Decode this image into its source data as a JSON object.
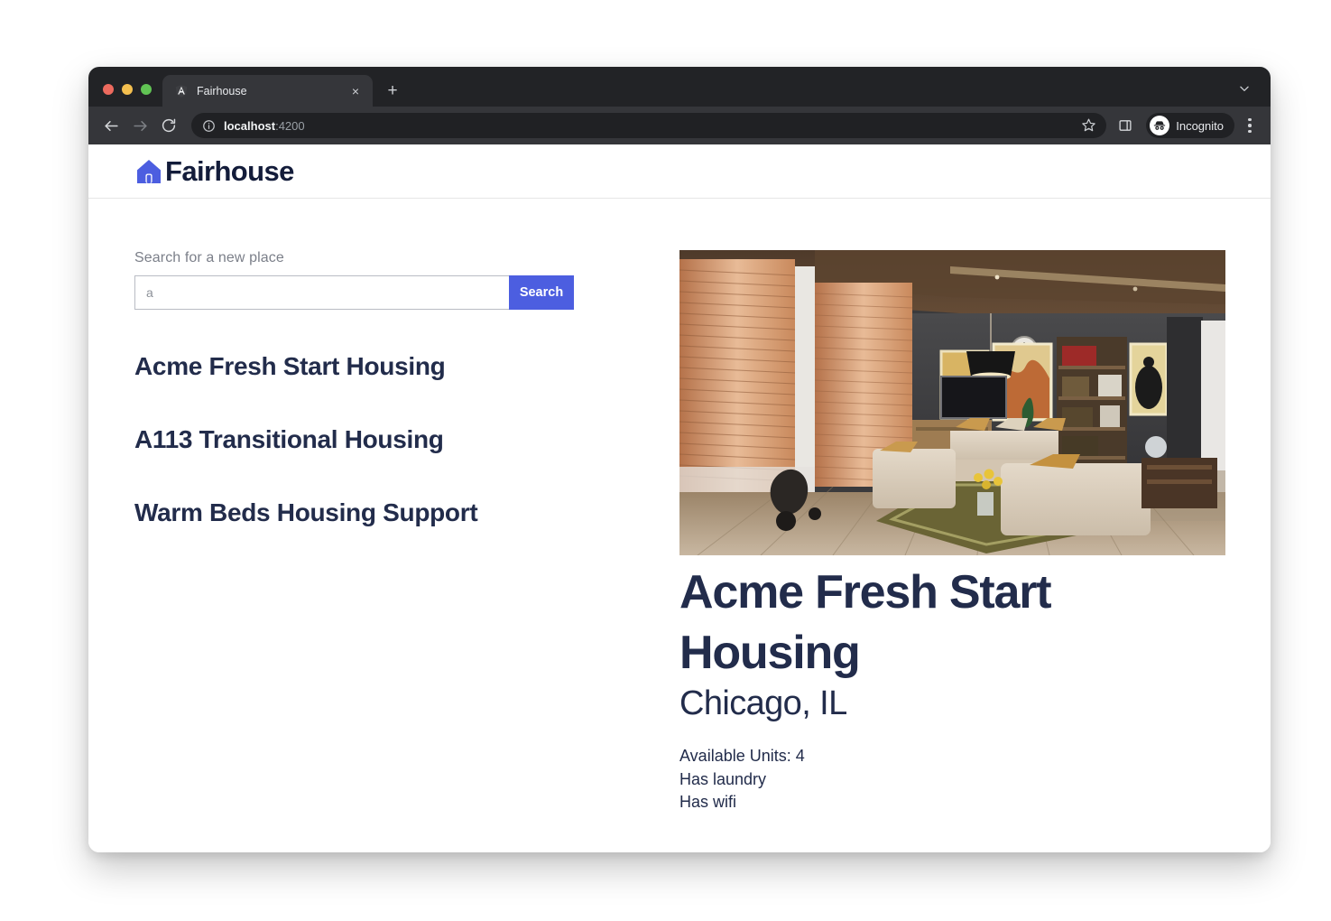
{
  "browser": {
    "tab": {
      "title": "Fairhouse",
      "favicon": "angular-shield-icon",
      "close": "×"
    },
    "new_tab_label": "+",
    "url_host": "localhost",
    "url_port": ":4200",
    "profile_label": "Incognito",
    "icons": {
      "back": "back-arrow-icon",
      "forward": "forward-arrow-icon",
      "reload": "reload-icon",
      "info": "site-info-icon",
      "bookmark": "star-icon",
      "side_panel": "side-panel-icon",
      "menu": "kebab-menu-icon",
      "tab_list": "chevron-down-icon"
    },
    "accent_tab_bg": "#35363a",
    "omnibox_bg": "#202124"
  },
  "site": {
    "brand": "Fairhouse",
    "brand_icon": "house-icon",
    "brand_color": "#4c5ee0",
    "text_color": "#222c4b"
  },
  "search": {
    "label": "Search for a new place",
    "value": "a",
    "placeholder": "",
    "button_label": "Search",
    "button_color": "#4c5ee0"
  },
  "housing_list": [
    {
      "name": "Acme Fresh Start Housing"
    },
    {
      "name": "A113 Transitional Housing"
    },
    {
      "name": "Warm Beds Housing Support"
    }
  ],
  "detail": {
    "photo_alt": "living-room-photo",
    "name": "Acme Fresh Start Housing",
    "city": "Chicago, IL",
    "features": [
      "Available Units: 4",
      "Has laundry",
      "Has wifi"
    ]
  }
}
